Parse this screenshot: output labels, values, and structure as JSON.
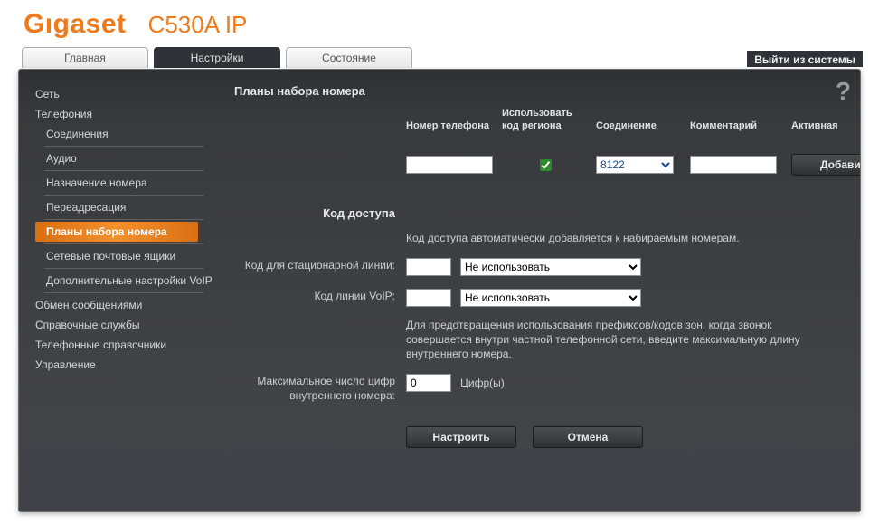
{
  "brand": "Gıgaset",
  "model": "C530A IP",
  "logout_label": "Выйти из системы",
  "tabs": [
    {
      "label": "Главная"
    },
    {
      "label": "Настройки"
    },
    {
      "label": "Состояние"
    }
  ],
  "sidebar": {
    "items": [
      "Сеть",
      "Телефония",
      "Обмен сообщениями",
      "Справочные службы",
      "Телефонные справочники",
      "Управление"
    ],
    "telephony_sub": [
      "Соединения",
      "Аудио",
      "Назначение номера",
      "Переадресация",
      "Планы набора номера",
      "Сетевые почтовые ящики",
      "Дополнительные настройки VoIP"
    ]
  },
  "content": {
    "dial_plans": {
      "title": "Планы набора номера",
      "headers": [
        "Номер телефона",
        "Использовать код региона",
        "Соединение",
        "Комментарий",
        "Активная"
      ],
      "row": {
        "phone": "",
        "use_region": true,
        "connection": "8122",
        "comment": "",
        "add_label": "Добавить"
      }
    },
    "access_code": {
      "title": "Код доступа",
      "note_top": "Код доступа автоматически добавляется к набираемым номерам.",
      "rows": [
        {
          "label": "Код для стационарной линии:",
          "code": "",
          "select": "Не использовать"
        },
        {
          "label": "Код линии VoIP:",
          "code": "",
          "select": "Не использовать"
        }
      ],
      "note_mid": "Для предотвращения использования префиксов/кодов зон, когда звонок совершается внутри частной телефонной сети, введите максимальную длину внутреннего номера.",
      "max_digits": {
        "label": "Максимальное число цифр внутреннего номера:",
        "value": "0",
        "suffix": "Цифр(ы)"
      }
    },
    "buttons": {
      "apply": "Настроить",
      "cancel": "Отмена"
    }
  }
}
